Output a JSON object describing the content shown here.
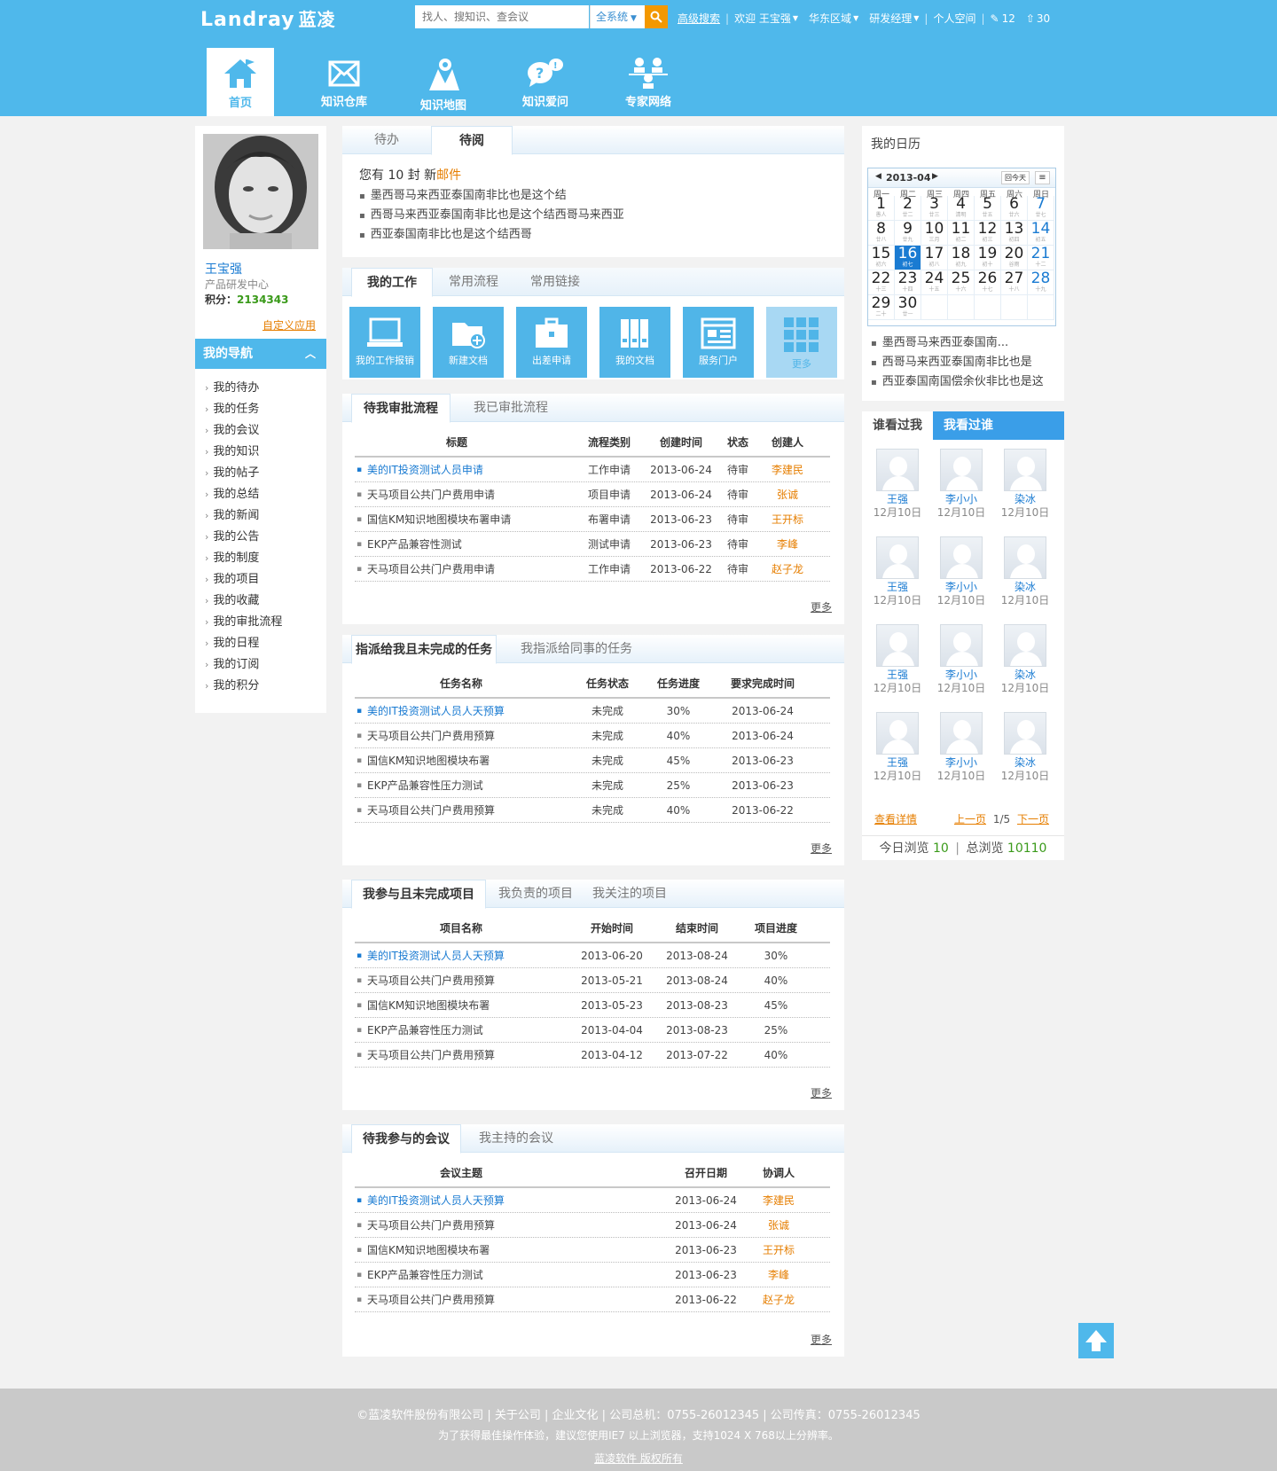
{
  "header": {
    "logo": "Landray",
    "logo_cn": "蓝凌",
    "search_placeholder": "找人、搜知识、查会议",
    "scope": "全系统",
    "advanced": "高级搜索",
    "welcome": "欢迎 王宝强",
    "region": "华东区域",
    "role": "研发经理",
    "space": "个人空间",
    "edit_count": "12",
    "up_count": "30"
  },
  "nav": [
    {
      "label": "首页"
    },
    {
      "label": "知识仓库"
    },
    {
      "label": "知识地图"
    },
    {
      "label": "知识爱问"
    },
    {
      "label": "专家网络"
    }
  ],
  "profile": {
    "name": "王宝强",
    "dept": "产品研发中心",
    "points_label": "积分：",
    "points": "2134343",
    "custom": "自定义应用"
  },
  "leftnav": {
    "title": "我的导航",
    "items": [
      "我的待办",
      "我的任务",
      "我的会议",
      "我的知识",
      "我的帖子",
      "我的总结",
      "我的新闻",
      "我的公告",
      "我的制度",
      "我的项目",
      "我的收藏",
      "我的审批流程",
      "我的日程",
      "我的订阅",
      "我的积分"
    ]
  },
  "todo": {
    "tabs": [
      "待办",
      "待阅"
    ],
    "mail_prefix": "您有 10 封 新",
    "mail_link": "邮件",
    "items": [
      "墨西哥马来西亚泰国南非比也是这个结",
      "西哥马来西亚泰国南非比也是这个结西哥马来西亚",
      "西亚泰国南非比也是这个结西哥"
    ]
  },
  "work": {
    "tabs": [
      "我的工作",
      "常用流程",
      "常用链接"
    ],
    "tiles": [
      "我的工作报销",
      "新建文档",
      "出差申请",
      "我的文档",
      "服务门户",
      "更多"
    ]
  },
  "approval": {
    "tabs": [
      "待我审批流程",
      "我已审批流程"
    ],
    "headers": [
      "标题",
      "流程类别",
      "创建时间",
      "状态",
      "创建人"
    ],
    "rows": [
      [
        "美的IT投资测试人员申请",
        "工作申请",
        "2013-06-24",
        "待审",
        "李建民"
      ],
      [
        "天马项目公共门户费用申请",
        "项目申请",
        "2013-06-24",
        "待审",
        "张诚"
      ],
      [
        "国信KM知识地图模块布署申请",
        "布署申请",
        "2013-06-23",
        "待审",
        "王开标"
      ],
      [
        "EKP产品兼容性测试",
        "测试申请",
        "2013-06-23",
        "待审",
        "李峰"
      ],
      [
        "天马项目公共门户费用申请",
        "工作申请",
        "2013-06-22",
        "待审",
        "赵子龙"
      ]
    ],
    "more": "更多"
  },
  "tasks": {
    "tabs": [
      "指派给我且未完成的任务",
      "我指派给同事的任务"
    ],
    "headers": [
      "任务名称",
      "任务状态",
      "任务进度",
      "要求完成时间"
    ],
    "rows": [
      [
        "美的IT投资测试人员人天预算",
        "未完成",
        "30%",
        "2013-06-24"
      ],
      [
        "天马项目公共门户费用预算",
        "未完成",
        "40%",
        "2013-06-24"
      ],
      [
        "国信KM知识地图模块布署",
        "未完成",
        "45%",
        "2013-06-23"
      ],
      [
        "EKP产品兼容性压力测试",
        "未完成",
        "25%",
        "2013-06-23"
      ],
      [
        "天马项目公共门户费用预算",
        "未完成",
        "40%",
        "2013-06-22"
      ]
    ],
    "more": "更多"
  },
  "projects": {
    "tabs": [
      "我参与且未完成项目",
      "我负责的项目",
      "我关注的项目"
    ],
    "headers": [
      "项目名称",
      "开始时间",
      "结束时间",
      "项目进度"
    ],
    "rows": [
      [
        "美的IT投资测试人员人天预算",
        "2013-06-20",
        "2013-08-24",
        "30%"
      ],
      [
        "天马项目公共门户费用预算",
        "2013-05-21",
        "2013-08-24",
        "40%"
      ],
      [
        "国信KM知识地图模块布署",
        "2013-05-23",
        "2013-08-23",
        "45%"
      ],
      [
        "EKP产品兼容性压力测试",
        "2013-04-04",
        "2013-08-23",
        "25%"
      ],
      [
        "天马项目公共门户费用预算",
        "2013-04-12",
        "2013-07-22",
        "40%"
      ]
    ],
    "more": "更多"
  },
  "meetings": {
    "tabs": [
      "待我参与的会议",
      "我主持的会议"
    ],
    "headers": [
      "会议主题",
      "召开日期",
      "协调人"
    ],
    "rows": [
      [
        "美的IT投资测试人员人天预算",
        "2013-06-24",
        "李建民"
      ],
      [
        "天马项目公共门户费用预算",
        "2013-06-24",
        "张诚"
      ],
      [
        "国信KM知识地图模块布署",
        "2013-06-23",
        "王开标"
      ],
      [
        "EKP产品兼容性压力测试",
        "2013-06-23",
        "李峰"
      ],
      [
        "天马项目公共门户费用预算",
        "2013-06-22",
        "赵子龙"
      ]
    ],
    "more": "更多"
  },
  "calendar": {
    "title": "我的日历",
    "month": "2013-04",
    "today_btn": "回今天",
    "weekdays": [
      "周一",
      "周二",
      "周三",
      "周四",
      "周五",
      "周六",
      "周日"
    ],
    "days": [
      [
        "1",
        "愚人"
      ],
      [
        "2",
        "廿二"
      ],
      [
        "3",
        "廿三"
      ],
      [
        "4",
        "清明"
      ],
      [
        "5",
        "廿五"
      ],
      [
        "6",
        "廿六"
      ],
      [
        "7",
        "廿七"
      ],
      [
        "8",
        "廿八"
      ],
      [
        "9",
        "廿九"
      ],
      [
        "10",
        "三月"
      ],
      [
        "11",
        "初二"
      ],
      [
        "12",
        "初三"
      ],
      [
        "13",
        "初四"
      ],
      [
        "14",
        "初五"
      ],
      [
        "15",
        "初六"
      ],
      [
        "16",
        "初七"
      ],
      [
        "17",
        "初八"
      ],
      [
        "18",
        "初九"
      ],
      [
        "19",
        "初十"
      ],
      [
        "20",
        "谷雨"
      ],
      [
        "21",
        "十二"
      ],
      [
        "22",
        "十三"
      ],
      [
        "23",
        "十四"
      ],
      [
        "24",
        "十五"
      ],
      [
        "25",
        "十六"
      ],
      [
        "26",
        "十七"
      ],
      [
        "27",
        "十八"
      ],
      [
        "28",
        "十九"
      ],
      [
        "29",
        "二十"
      ],
      [
        "30",
        "廿一"
      ]
    ],
    "today": "16",
    "events": [
      "墨西哥马来西亚泰国南...",
      "西哥马来西亚泰国南非比也是",
      "西亚泰国南国偿余伙非比也是这"
    ]
  },
  "visitors": {
    "tabs": [
      "谁看过我",
      "我看过谁"
    ],
    "people": [
      [
        "王强",
        "12月10日"
      ],
      [
        "李小小",
        "12月10日"
      ],
      [
        "染冰",
        "12月10日"
      ],
      [
        "王强",
        "12月10日"
      ],
      [
        "李小小",
        "12月10日"
      ],
      [
        "染冰",
        "12月10日"
      ],
      [
        "王强",
        "12月10日"
      ],
      [
        "李小小",
        "12月10日"
      ],
      [
        "染冰",
        "12月10日"
      ],
      [
        "王强",
        "12月10日"
      ],
      [
        "李小小",
        "12月10日"
      ],
      [
        "染冰",
        "12月10日"
      ]
    ],
    "detail": "查看详情",
    "prev": "上一页",
    "page": "1/5",
    "next": "下一页",
    "today_label": "今日浏览",
    "today_count": "10",
    "total_label": "总浏览",
    "total_count": "10110"
  },
  "footer": {
    "line1": "©蓝凌软件股份有限公司 | 关于公司 | 企业文化 | 公司总机：0755-26012345 | 公司传真：0755-26012345",
    "line2": "为了获得最佳操作体验，建议您使用IE7 以上浏览器，支持1024 X 768以上分辨率。",
    "line3": "蓝凌软件 版权所有"
  }
}
